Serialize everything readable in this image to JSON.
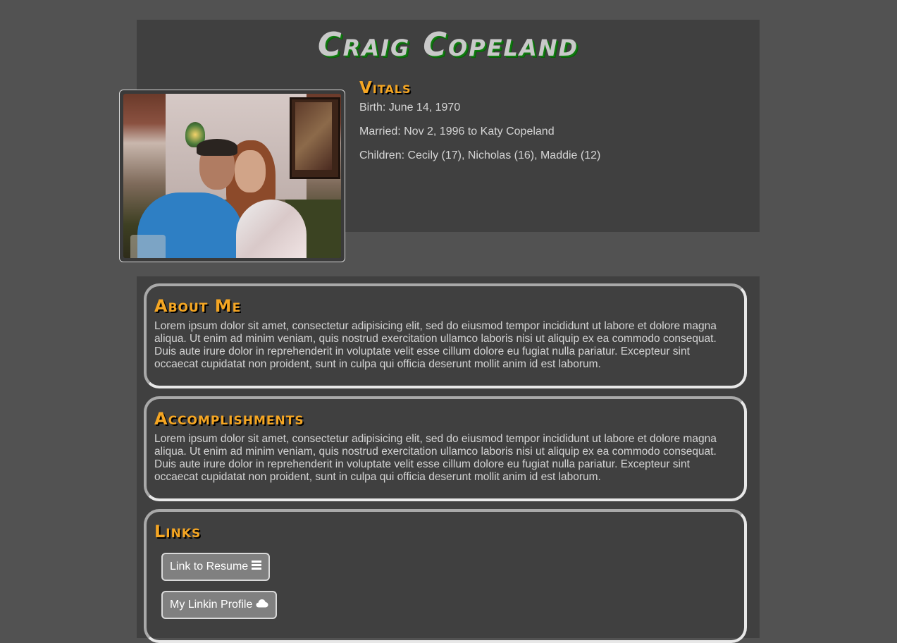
{
  "header": {
    "name": "Craig Copeland"
  },
  "vitals": {
    "heading": "Vitals",
    "birth": "Birth: June 14, 1970",
    "married": "Married: Nov 2, 1996 to Katy Copeland",
    "children": "Children: Cecily (17), Nicholas (16), Maddie (12)"
  },
  "about": {
    "heading": "About Me",
    "text": "Lorem ipsum dolor sit amet, consectetur adipisicing elit, sed do eiusmod tempor incididunt ut labore et dolore magna aliqua. Ut enim ad minim veniam, quis nostrud exercitation ullamco laboris nisi ut aliquip ex ea commodo consequat. Duis aute irure dolor in reprehenderit in voluptate velit esse cillum dolore eu fugiat nulla pariatur. Excepteur sint occaecat cupidatat non proident, sunt in culpa qui officia deserunt mollit anim id est laborum."
  },
  "accomplishments": {
    "heading": "Accomplishments",
    "text": "Lorem ipsum dolor sit amet, consectetur adipisicing elit, sed do eiusmod tempor incididunt ut labore et dolore magna aliqua. Ut enim ad minim veniam, quis nostrud exercitation ullamco laboris nisi ut aliquip ex ea commodo consequat. Duis aute irure dolor in reprehenderit in voluptate velit esse cillum dolore eu fugiat nulla pariatur. Excepteur sint occaecat cupidatat non proident, sunt in culpa qui officia deserunt mollit anim id est laborum."
  },
  "links": {
    "heading": "Links",
    "resume_label": "Link to Resume",
    "resume_icon": "menu-lines-icon",
    "linkedin_label": "My Linkin Profile",
    "linkedin_icon": "cloud-icon"
  },
  "colors": {
    "page_bg": "#525252",
    "panel_bg": "#404040",
    "heading_accent": "#f5a623",
    "title_shadow": "#0f7a0f",
    "button_bg": "#808080"
  }
}
